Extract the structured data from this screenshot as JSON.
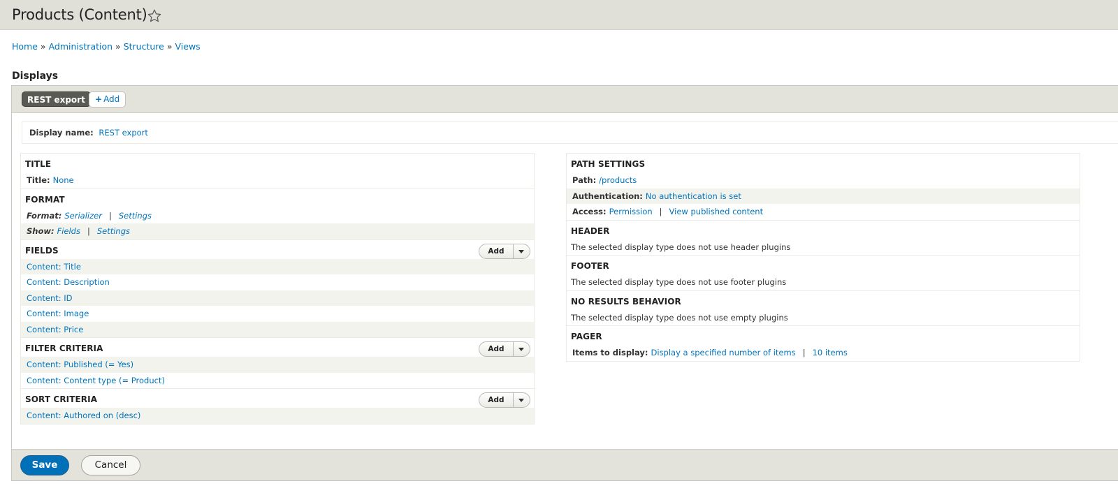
{
  "page": {
    "title": "Products (Content)",
    "star_icon": "star-outline-icon"
  },
  "breadcrumb": {
    "items": [
      "Home",
      "Administration",
      "Structure",
      "Views"
    ],
    "separator": "»"
  },
  "displays": {
    "heading": "Displays",
    "tabs": {
      "active": "REST export",
      "add_symbol": "+",
      "add_label": "Add"
    },
    "display_name": {
      "label": "Display name:",
      "value": "REST export"
    }
  },
  "left": {
    "title": {
      "heading": "TITLE",
      "label": "Title:",
      "value": "None"
    },
    "format": {
      "heading": "FORMAT",
      "format_label": "Format:",
      "format_value": "Serializer",
      "format_settings": "Settings",
      "show_label": "Show:",
      "show_value": "Fields",
      "show_settings": "Settings",
      "pipe": "|"
    },
    "fields": {
      "heading": "FIELDS",
      "add": "Add",
      "items": [
        "Content: Title",
        "Content: Description",
        "Content: ID",
        "Content: Image",
        "Content: Price"
      ]
    },
    "filters": {
      "heading": "FILTER CRITERIA",
      "add": "Add",
      "items": [
        "Content: Published (= Yes)",
        "Content: Content type (= Product)"
      ]
    },
    "sorts": {
      "heading": "SORT CRITERIA",
      "add": "Add",
      "items": [
        "Content: Authored on (desc)"
      ]
    }
  },
  "right": {
    "path_settings": {
      "heading": "PATH SETTINGS",
      "path_label": "Path:",
      "path_value": "/products",
      "auth_label": "Authentication:",
      "auth_value": "No authentication is set",
      "access_label": "Access:",
      "access_value": "Permission",
      "access_detail": "View published content",
      "pipe": "|"
    },
    "header": {
      "heading": "HEADER",
      "text": "The selected display type does not use header plugins"
    },
    "footer": {
      "heading": "FOOTER",
      "text": "The selected display type does not use footer plugins"
    },
    "no_results": {
      "heading": "NO RESULTS BEHAVIOR",
      "text": "The selected display type does not use empty plugins"
    },
    "pager": {
      "heading": "PAGER",
      "label": "Items to display:",
      "value": "Display a specified number of items",
      "count": "10 items",
      "pipe": "|"
    }
  },
  "actions": {
    "save": "Save",
    "cancel": "Cancel"
  },
  "colors": {
    "link": "#0074bd",
    "primary": "#0071b8",
    "header_bg": "#e0e0d8",
    "row_alt": "#f3f3ee"
  }
}
